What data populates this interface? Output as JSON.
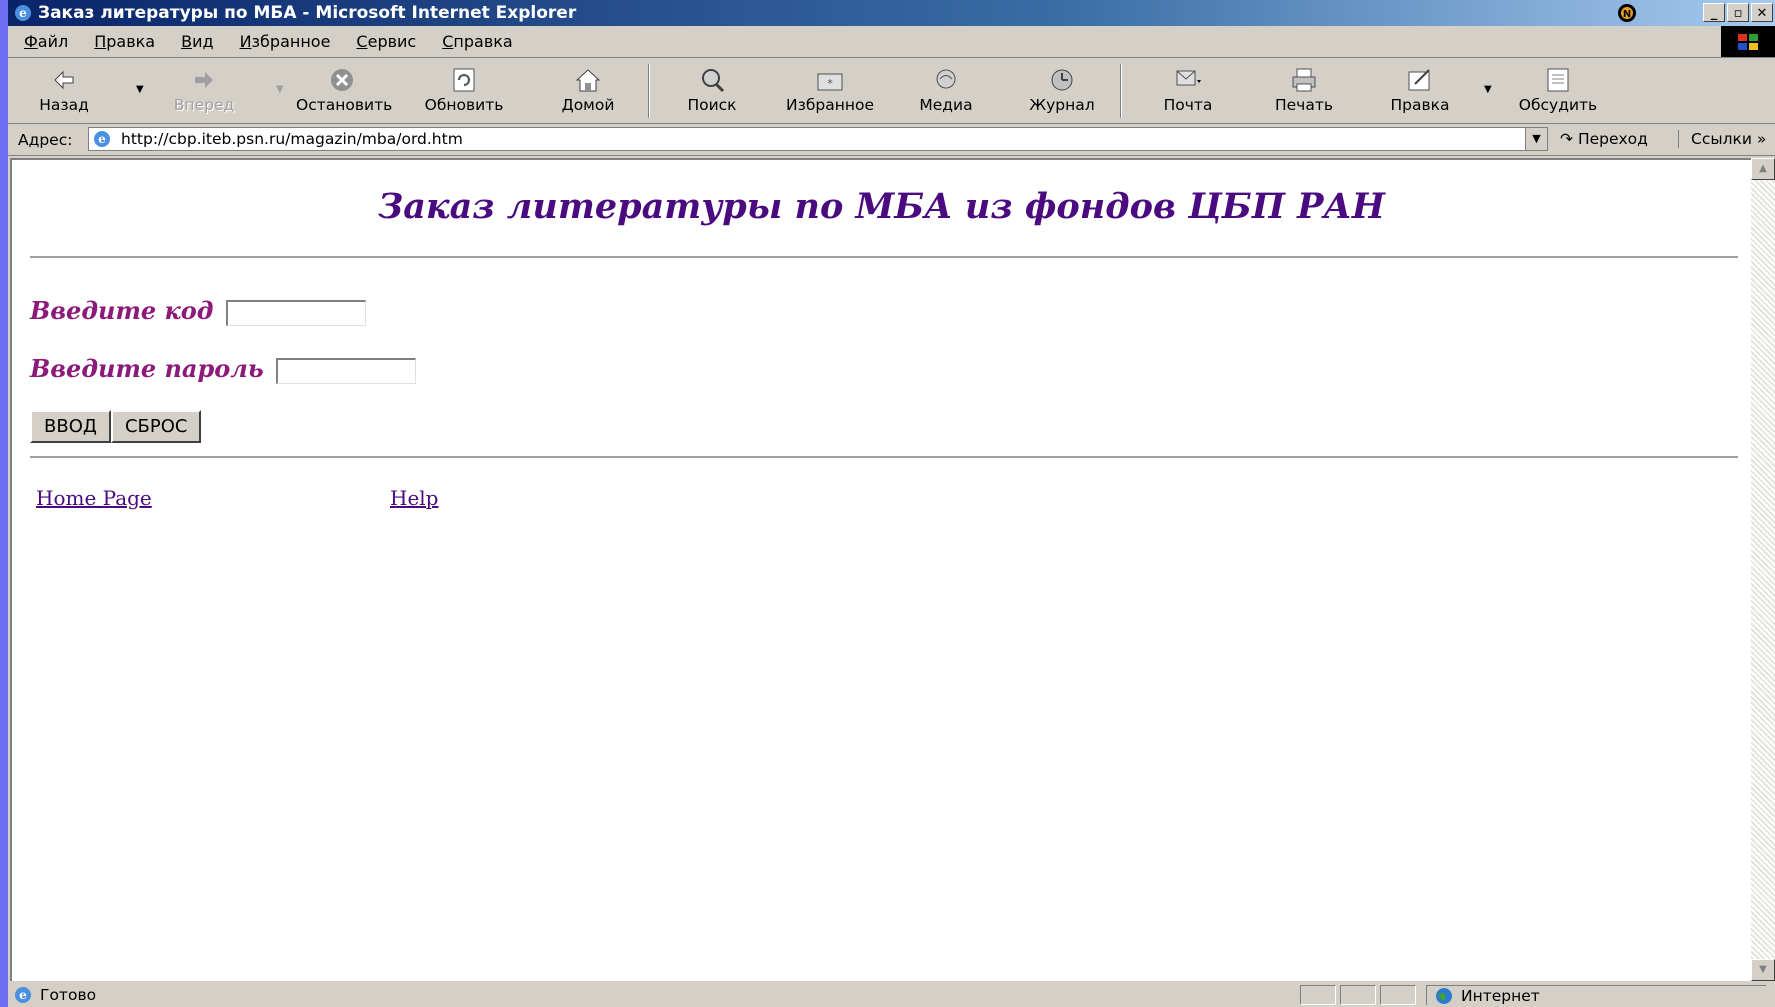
{
  "window": {
    "title": "Заказ литературы по МБА - Microsoft Internet Explorer",
    "controls": [
      "_",
      "▫",
      "✕"
    ]
  },
  "menu": [
    "Файл",
    "Правка",
    "Вид",
    "Избранное",
    "Сервис",
    "Справка"
  ],
  "toolbar": {
    "back": "Назад",
    "forward": "Вперед",
    "stop": "Остановить",
    "refresh": "Обновить",
    "home": "Домой",
    "search": "Поиск",
    "favorites": "Избранное",
    "media": "Медиа",
    "history": "Журнал",
    "mail": "Почта",
    "print": "Печать",
    "edit": "Правка",
    "discuss": "Обсудить"
  },
  "address": {
    "label": "Адрес:",
    "url": "http://cbp.iteb.psn.ru/magazin/mba/ord.htm",
    "go": "Переход",
    "links": "Ссылки"
  },
  "page": {
    "title": "Заказ литературы по МБА из фондов ЦБП РАН",
    "code_label": "Введите код",
    "password_label": "Введите пароль",
    "code_value": "",
    "password_value": "",
    "submit_label": "ВВОД",
    "reset_label": "СБРОС",
    "home_link": "Home Page",
    "help_link": "Help"
  },
  "status": {
    "text": "Готово",
    "zone": "Интернет"
  }
}
